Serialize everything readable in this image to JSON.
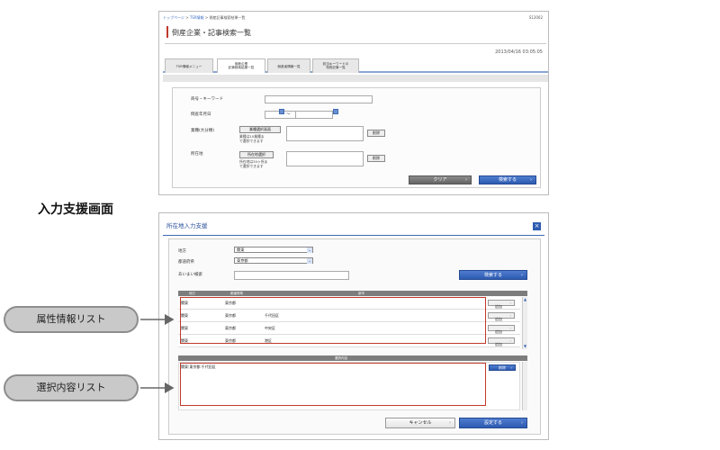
{
  "top_screen": {
    "breadcrumb": {
      "home": "トップページ",
      "sep": ">",
      "menu": "TSR情報",
      "current": "倒産記事検索結果一覧"
    },
    "screen_id": "S12002",
    "title": "倒産企業・記事検索一覧",
    "datetime": "2013/04/16 03:05:05",
    "tabs": [
      {
        "label": "TSR情報メニュー"
      },
      {
        "label": "倒産企業\n記事検索結果一覧"
      },
      {
        "label": "倒産者情報一覧"
      },
      {
        "label": "該当キーワードの\n特別記事一覧"
      }
    ],
    "form": {
      "company_label": "商号・キーワード",
      "date_label": "倒産年月日",
      "date_sep": "～",
      "industry_label": "業種(大分類)",
      "industry_button": "業種選択画面",
      "industry_note": "業種は10業種ま\nで選択できます",
      "location_label": "所在地",
      "location_button": "所在地選択",
      "location_note": "所在地は30ヶ所ま\nで選択できます",
      "delete_label": "削除",
      "clear_button": "クリア",
      "search_button": "検索する",
      "arrow": "›"
    }
  },
  "heading": "入力支援画面",
  "dialog": {
    "title": "所在地入力支援",
    "close_glyph": "×",
    "region_label": "地方",
    "region_value": "関東",
    "pref_label": "都道府県",
    "pref_value": "東京都",
    "fuzzy_label": "あいまい検索",
    "search_button": "検索する",
    "chev": "⌄",
    "arrow": "›",
    "attr_headers": {
      "region": "地方",
      "pref": "都道府県",
      "name": "部市"
    },
    "attr_rows": [
      {
        "region": "関東",
        "pref": "東京都",
        "city": "",
        "add": "追加"
      },
      {
        "region": "関東",
        "pref": "東京都",
        "city": "千代田区",
        "add": "追加"
      },
      {
        "region": "関東",
        "pref": "東京都",
        "city": "中央区",
        "add": "追加"
      },
      {
        "region": "関東",
        "pref": "東京都",
        "city": "港区",
        "add": "追加"
      }
    ],
    "selected_header": "選択内容",
    "selected_items": [
      "関東:東京都:千代田区"
    ],
    "delete_button": "削除",
    "cancel_button": "キャンセル",
    "confirm_button": "設定する"
  },
  "callouts": {
    "attribute_list": "属性情報リスト",
    "selection_list": "選択内容リスト"
  },
  "colors": {
    "accent_red": "#c0392b",
    "brand_blue": "#2d5bb0",
    "callout_gray": "#c9c9c9"
  }
}
